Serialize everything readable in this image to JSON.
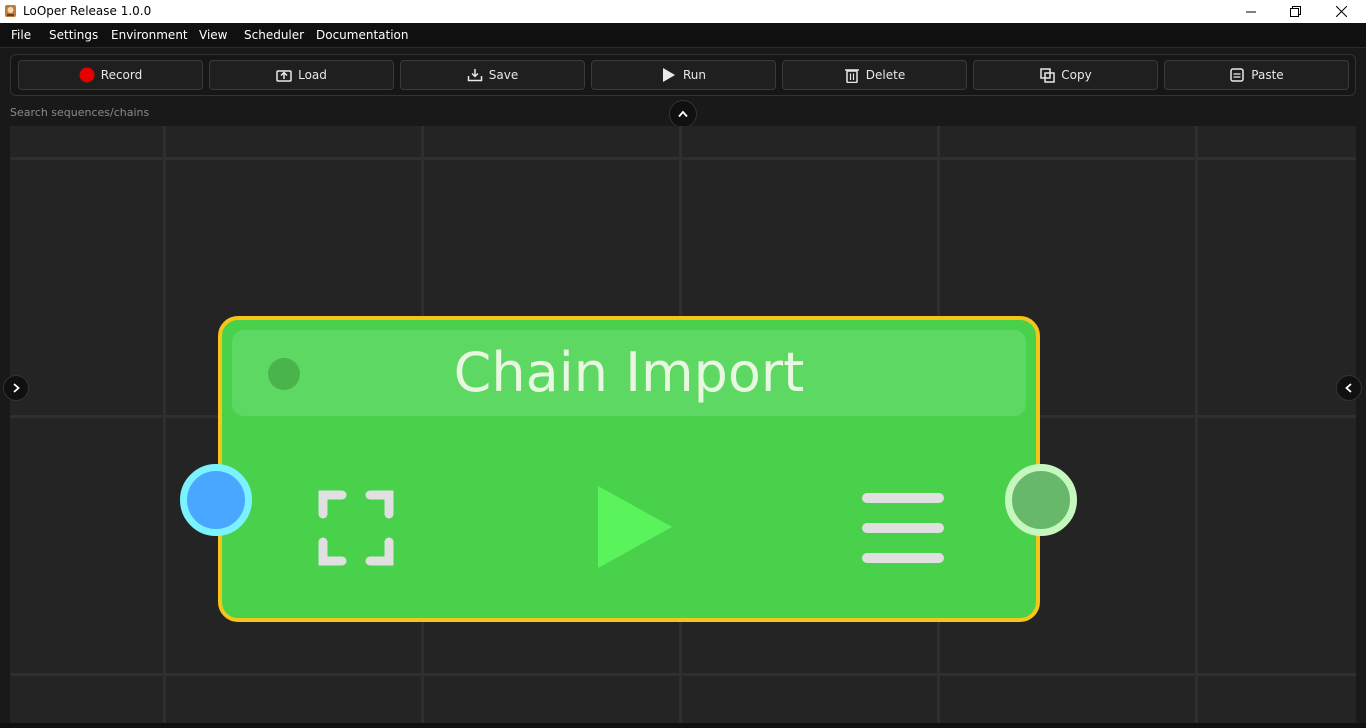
{
  "window": {
    "title": "LoOper Release 1.0.0"
  },
  "menu": [
    {
      "label": "File"
    },
    {
      "label": "Settings"
    },
    {
      "label": "Environment"
    },
    {
      "label": "View"
    },
    {
      "label": "Scheduler"
    },
    {
      "label": "Documentation"
    }
  ],
  "toolbar": {
    "record_label": "Record",
    "load_label": "Load",
    "save_label": "Save",
    "run_label": "Run",
    "delete_label": "Delete",
    "copy_label": "Copy",
    "paste_label": "Paste"
  },
  "search": {
    "placeholder": "Search sequences/chains",
    "value": ""
  },
  "node": {
    "title": "Chain Import"
  },
  "colors": {
    "record": "#e60000",
    "node_fill": "#49d14c",
    "node_border": "#f5c518",
    "port_in": "#49a7ff",
    "port_out": "#68b86c",
    "run_triangle": "#5af35c"
  },
  "icons": {
    "record": "record-icon",
    "load": "load-icon",
    "save": "save-icon",
    "run": "play-icon",
    "delete": "trash-icon",
    "copy": "copy-icon",
    "paste": "paste-icon",
    "collapse": "chevron-up-icon",
    "left_panel": "chevron-right-icon",
    "right_panel": "chevron-left-icon",
    "expand": "expand-icon",
    "node_run": "play-icon",
    "node_menu": "menu-icon"
  }
}
